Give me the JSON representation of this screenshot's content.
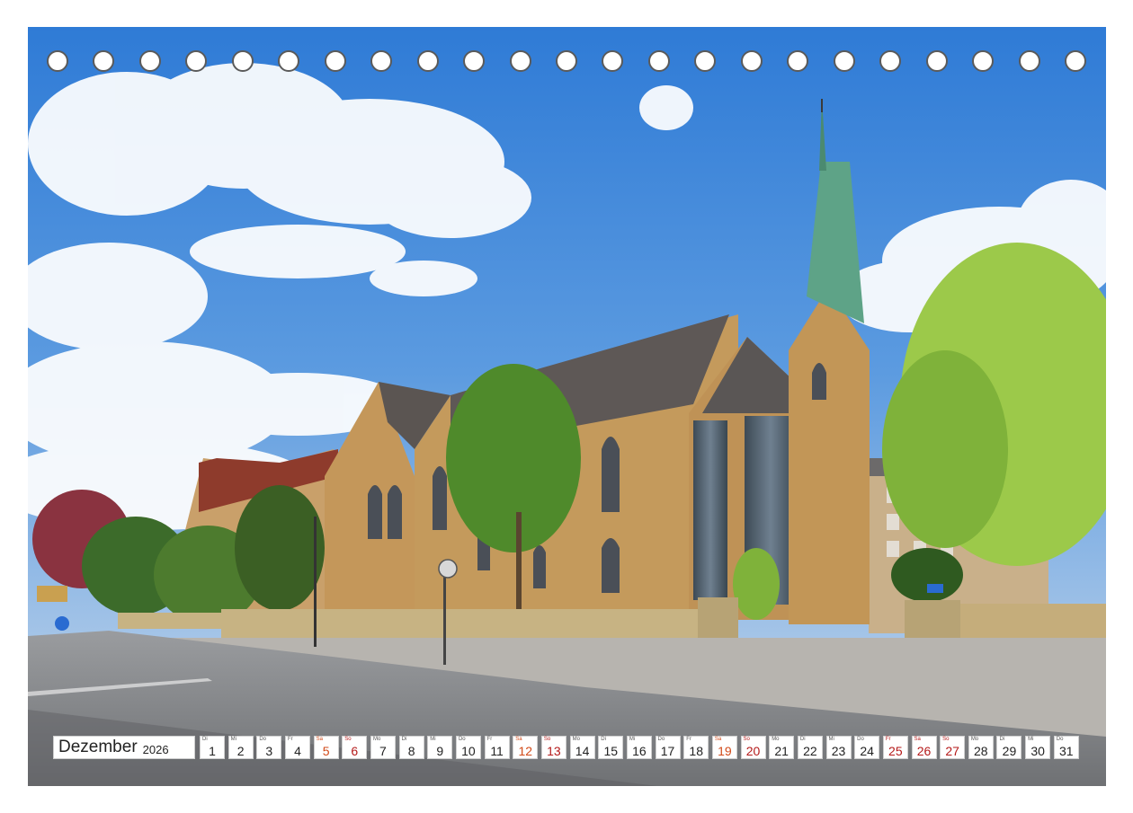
{
  "calendar": {
    "month": "Dezember",
    "year": "2026",
    "days": [
      {
        "num": "1",
        "abbr": "Di",
        "type": "weekday"
      },
      {
        "num": "2",
        "abbr": "Mi",
        "type": "weekday"
      },
      {
        "num": "3",
        "abbr": "Do",
        "type": "weekday"
      },
      {
        "num": "4",
        "abbr": "Fr",
        "type": "weekday"
      },
      {
        "num": "5",
        "abbr": "Sa",
        "type": "sat"
      },
      {
        "num": "6",
        "abbr": "So",
        "type": "sun"
      },
      {
        "num": "7",
        "abbr": "Mo",
        "type": "weekday"
      },
      {
        "num": "8",
        "abbr": "Di",
        "type": "weekday"
      },
      {
        "num": "9",
        "abbr": "Mi",
        "type": "weekday"
      },
      {
        "num": "10",
        "abbr": "Do",
        "type": "weekday"
      },
      {
        "num": "11",
        "abbr": "Fr",
        "type": "weekday"
      },
      {
        "num": "12",
        "abbr": "Sa",
        "type": "sat"
      },
      {
        "num": "13",
        "abbr": "So",
        "type": "sun"
      },
      {
        "num": "14",
        "abbr": "Mo",
        "type": "weekday"
      },
      {
        "num": "15",
        "abbr": "Di",
        "type": "weekday"
      },
      {
        "num": "16",
        "abbr": "Mi",
        "type": "weekday"
      },
      {
        "num": "17",
        "abbr": "Do",
        "type": "weekday"
      },
      {
        "num": "18",
        "abbr": "Fr",
        "type": "weekday"
      },
      {
        "num": "19",
        "abbr": "Sa",
        "type": "sat"
      },
      {
        "num": "20",
        "abbr": "So",
        "type": "sun"
      },
      {
        "num": "21",
        "abbr": "Mo",
        "type": "weekday"
      },
      {
        "num": "22",
        "abbr": "Di",
        "type": "weekday"
      },
      {
        "num": "23",
        "abbr": "Mi",
        "type": "weekday"
      },
      {
        "num": "24",
        "abbr": "Do",
        "type": "weekday"
      },
      {
        "num": "25",
        "abbr": "Fr",
        "type": "holiday"
      },
      {
        "num": "26",
        "abbr": "Sa",
        "type": "holiday"
      },
      {
        "num": "27",
        "abbr": "So",
        "type": "sun"
      },
      {
        "num": "28",
        "abbr": "Mo",
        "type": "weekday"
      },
      {
        "num": "29",
        "abbr": "Di",
        "type": "weekday"
      },
      {
        "num": "30",
        "abbr": "Mi",
        "type": "weekday"
      },
      {
        "num": "31",
        "abbr": "Do",
        "type": "weekday"
      }
    ]
  },
  "binding": {
    "hole_count": 23
  },
  "colors": {
    "sky": "#3f86d6",
    "brick": "#c49a5c",
    "roof": "#5b5552",
    "spire": "#5ea387",
    "foliage": "#7fb23a",
    "road": "#8f9194",
    "saturday": "#d24a18",
    "sunday": "#b51a1a"
  }
}
